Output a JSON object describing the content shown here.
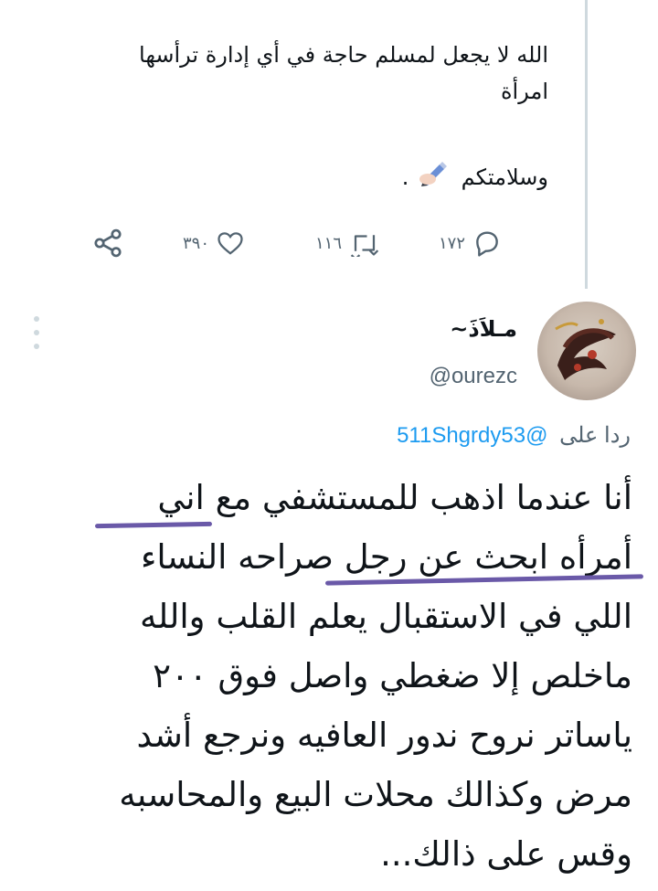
{
  "previous_tweet": {
    "line1": "الله لا يجعل لمسلم حاجة في أي إدارة ترأسها",
    "line2": "امرأة",
    "sign_text": "وسلامتكم",
    "sign_emoji": "✍🏻",
    "sign_dot": ".",
    "actions": {
      "reply_count": "١٧٢",
      "retweet_count": "١١٦",
      "like_count": "٣٩٠"
    }
  },
  "reply_tweet": {
    "author_name": "مـلاَذَ~",
    "author_handle": "@ourezc",
    "reply_prefix": "ردا على",
    "reply_handle": "@511Shgrdy53",
    "body_lines": [
      "أنا عندما اذهب للمستشفي مع اني",
      "أمرأه ابحث عن رجل صراحه النساء",
      "اللي في الاستقبال يعلم القلب والله",
      "ماخلص إلا ضغطي واصل فوق ٢٠٠",
      "ياساتر نروح ندور العافيه ونرجع أشد",
      "مرض وكذالك محلات البيع والمحاسبه",
      "وقس على ذالك..."
    ]
  },
  "colors": {
    "text_primary": "#0f1419",
    "text_secondary": "#536471",
    "link": "#1d9bf0",
    "thread_line": "#cfd9de",
    "annotation_underline": "#6a59a8"
  },
  "icons": {
    "reply": "reply-icon",
    "retweet": "retweet-icon",
    "like": "heart-icon",
    "share": "share-icon",
    "more": "more-vertical-icon"
  }
}
